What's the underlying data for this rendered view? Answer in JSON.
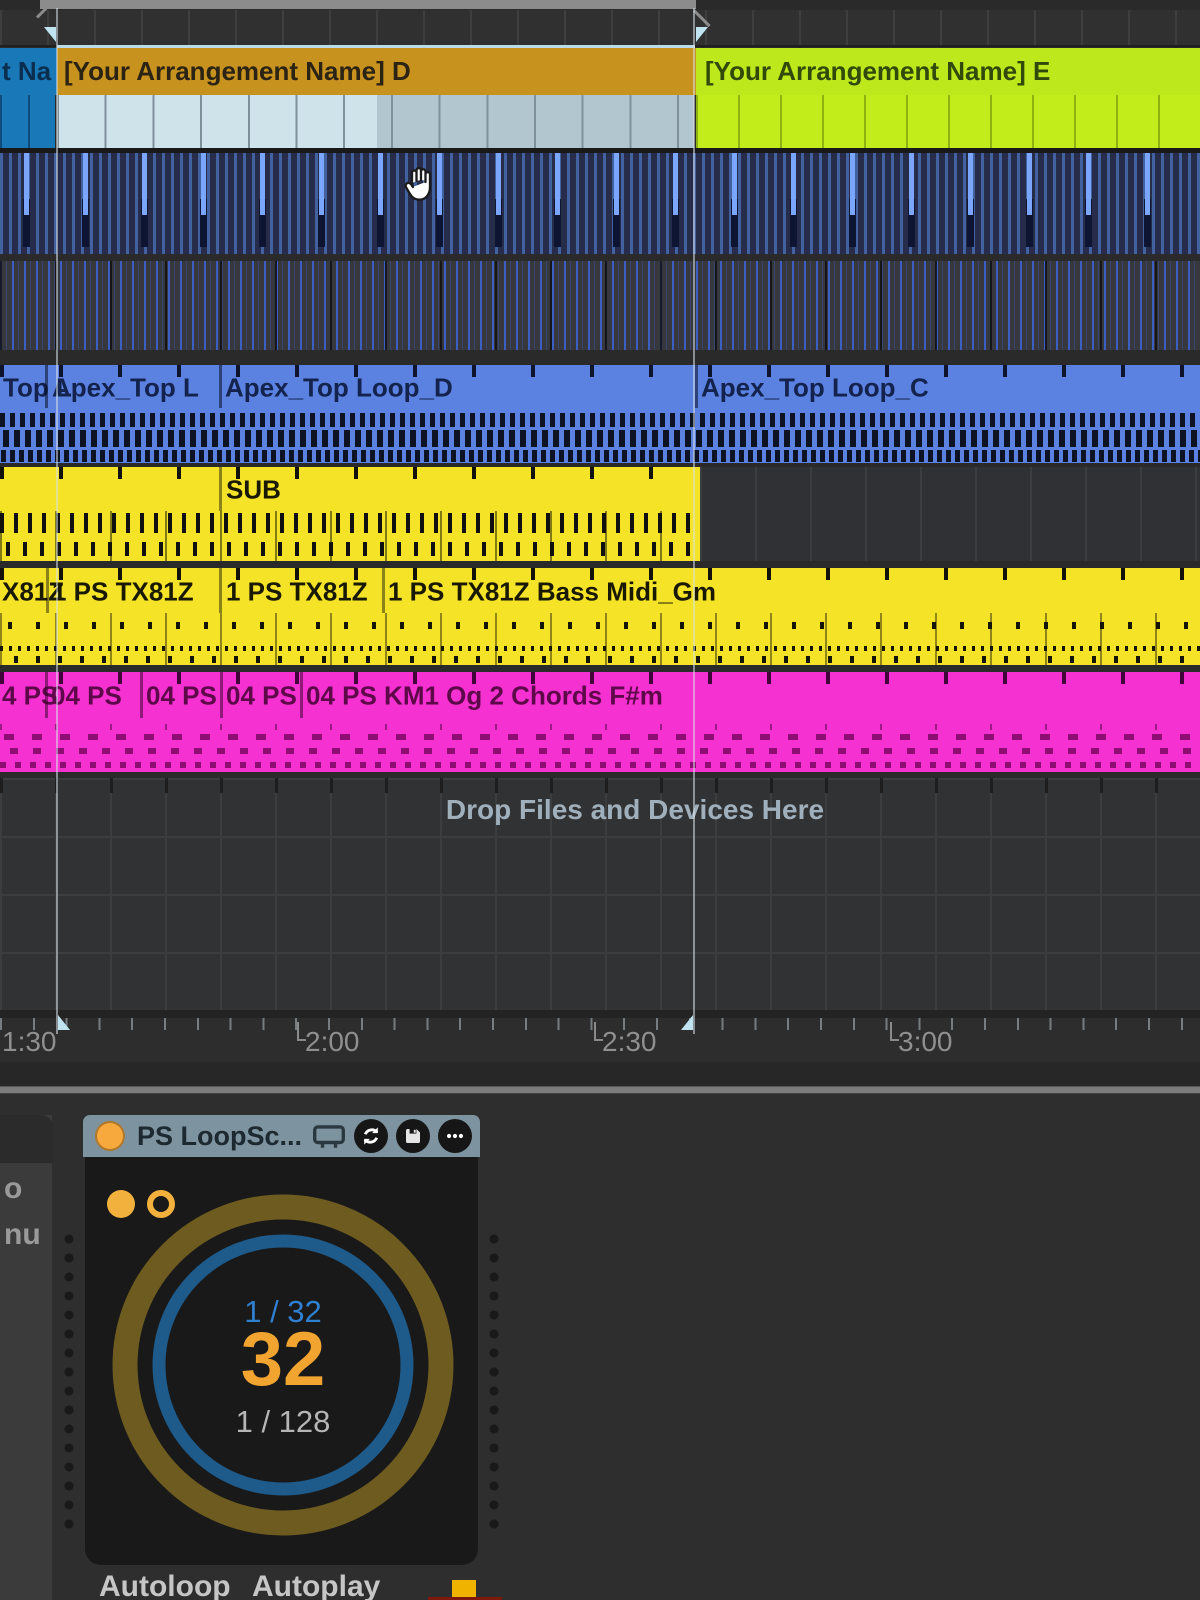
{
  "arrangement": {
    "sections": {
      "left_partial": {
        "label": "t Na",
        "color": "#1878b8"
      },
      "d": {
        "label": "[Your Arrangement Name] D",
        "color": "#c8921f"
      },
      "e": {
        "label": "[Your Arrangement Name] E",
        "color": "#bce81c"
      }
    },
    "tracks": {
      "audio_top_loop": {
        "color": "#5b82e0",
        "clips": [
          {
            "label": "Top L"
          },
          {
            "label": "Apex_Top L"
          },
          {
            "label": "Apex_Top Loop_D"
          },
          {
            "label": "Apex_Top Loop_C"
          }
        ]
      },
      "sub": {
        "color": "#f5e327",
        "clips": [
          {
            "label": ""
          },
          {
            "label": "SUB"
          }
        ]
      },
      "bass": {
        "color": "#f5e327",
        "clips": [
          {
            "label": "X81Z"
          },
          {
            "label": "1 PS TX81Z"
          },
          {
            "label": "1 PS TX81Z"
          },
          {
            "label": "1 PS TX81Z Bass Midi_Gm"
          }
        ]
      },
      "chords": {
        "color": "#f531d1",
        "clips": [
          {
            "label": "4 PS"
          },
          {
            "label": "04 PS"
          },
          {
            "label": "04 PS"
          },
          {
            "label": "04 PS"
          },
          {
            "label": "04 PS KM1 Og 2 Chords F#m"
          }
        ]
      }
    },
    "drop_zone_text": "Drop Files and Devices Here",
    "ruler": {
      "labels": [
        "1:30",
        "2:00",
        "2:30",
        "3:00"
      ]
    }
  },
  "device_panel": {
    "sidebar_partial_labels": [
      "o",
      "nu"
    ],
    "device": {
      "title": "PS LoopSc...",
      "title_bar_color": "#7e93a0",
      "activator_color": "#f7a93d",
      "dial": {
        "top_value": "1 / 32",
        "main_value": "32",
        "bottom_value": "1 / 128",
        "top_color": "#2f80d0",
        "main_color": "#f2a431",
        "outer_ring_color": "#6e5b20",
        "inner_ring_color": "#1e5a8a"
      },
      "toggles": [
        {
          "label": "Autoloop"
        },
        {
          "label": "Autoplay"
        }
      ]
    }
  }
}
